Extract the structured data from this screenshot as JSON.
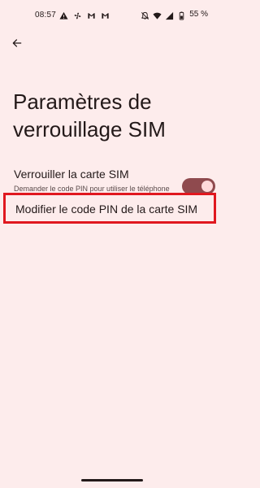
{
  "status_bar": {
    "time": "08:57",
    "left_icons": [
      "warning-icon",
      "fan-icon",
      "gmail-icon",
      "gmail-icon"
    ],
    "right_icons": [
      "notifications-off-icon",
      "wifi-icon",
      "signal-icon",
      "battery-icon"
    ],
    "battery": "55 %"
  },
  "header": {
    "back_icon": "arrow-back-icon",
    "title": "Paramètres de verrouillage SIM"
  },
  "settings": {
    "lock_sim": {
      "title": "Verrouiller la carte SIM",
      "summary": "Demander le code PIN pour utiliser le téléphone",
      "enabled": true
    },
    "change_pin": {
      "label": "Modifier le code PIN de la carte SIM"
    }
  },
  "colors": {
    "background": "#fdecec",
    "accent": "#8f4a4e",
    "highlight_border": "#e0171f"
  }
}
